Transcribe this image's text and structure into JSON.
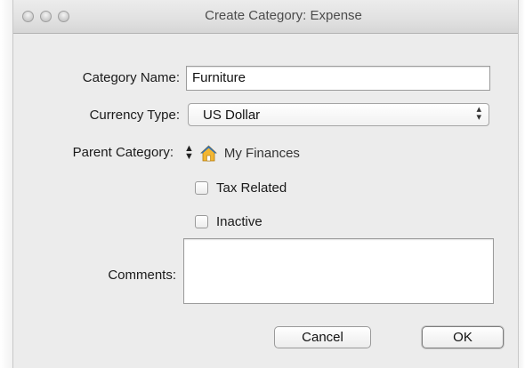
{
  "window": {
    "title": "Create Category: Expense"
  },
  "form": {
    "category_name_label": "Category Name:",
    "category_name_value": "Furniture",
    "currency_type_label": "Currency Type:",
    "currency_type_value": "US Dollar",
    "parent_category_label": "Parent Category:",
    "parent_category_value": "My Finances",
    "tax_related_label": "Tax Related",
    "tax_related_checked": false,
    "inactive_label": "Inactive",
    "inactive_checked": false,
    "comments_label": "Comments:",
    "comments_value": ""
  },
  "buttons": {
    "cancel_label": "Cancel",
    "ok_label": "OK"
  },
  "icons": {
    "parent_stepper": "up-down-arrows-icon",
    "parent_home": "house-icon",
    "popup_arrows": "chevron-up-down-icon"
  },
  "colors": {
    "window_bg": "#ececec",
    "house_roof": "#2f6fb5",
    "house_body": "#f2b632"
  }
}
